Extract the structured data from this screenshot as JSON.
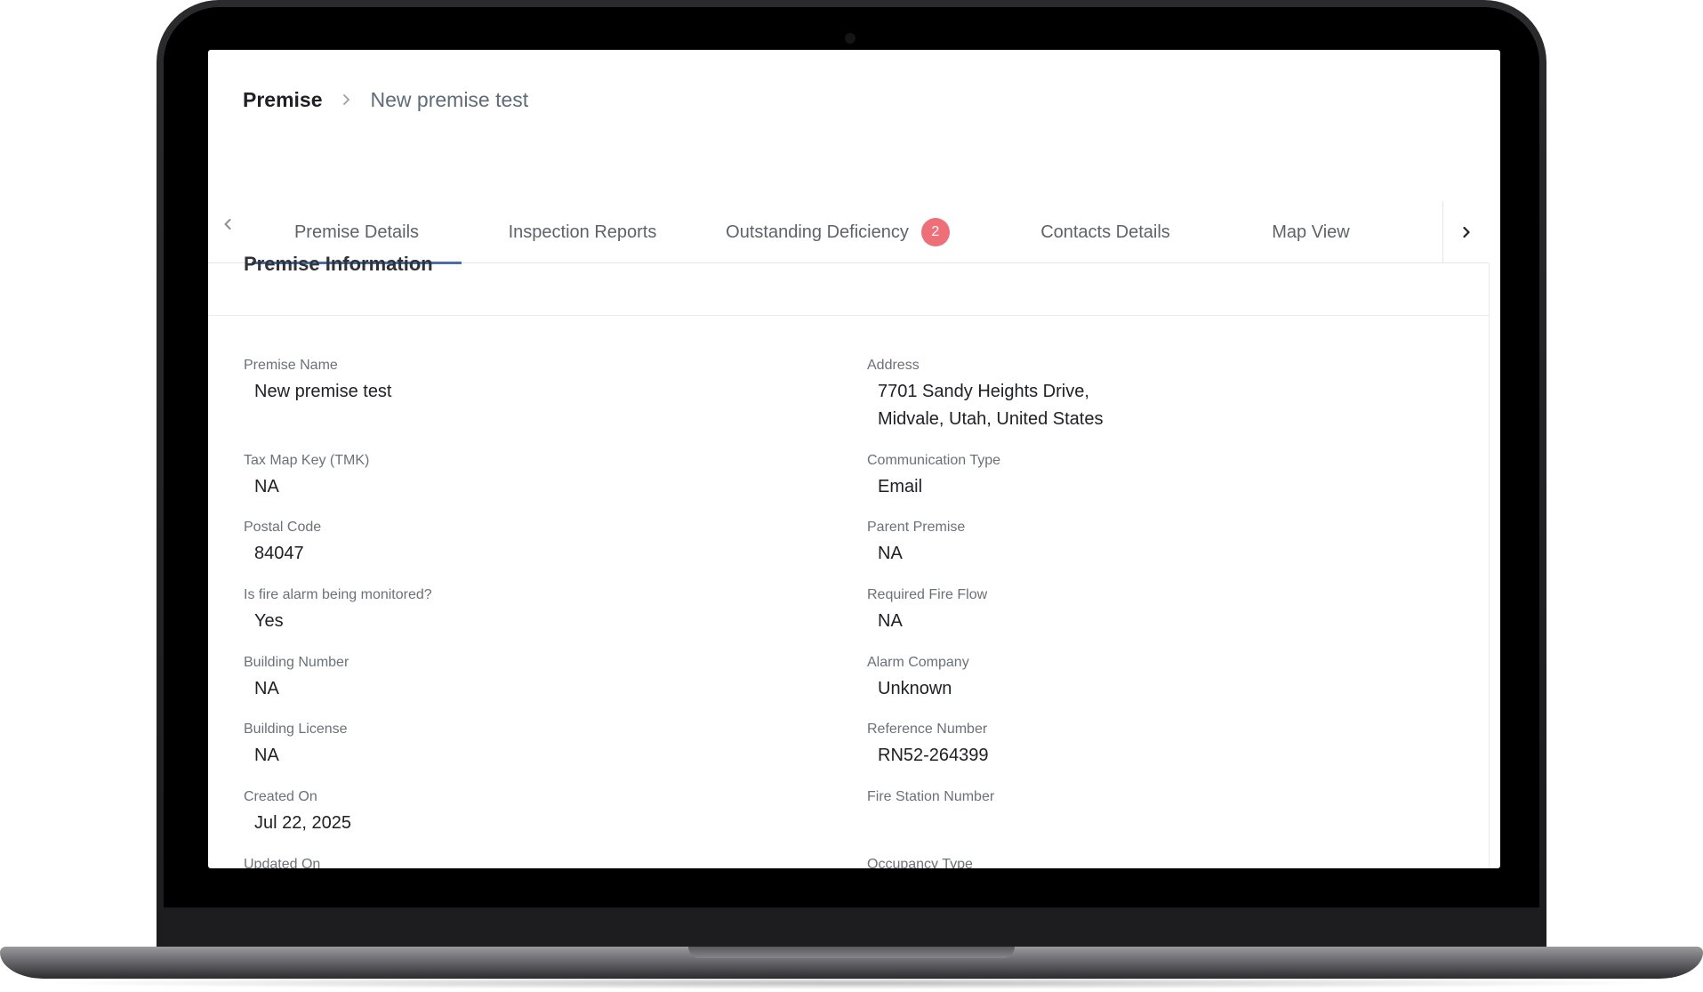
{
  "breadcrumb": {
    "root": "Premise",
    "current": "New premise test"
  },
  "tabs": [
    {
      "label": "Premise Details",
      "active": true
    },
    {
      "label": "Inspection Reports"
    },
    {
      "label": "Outstanding Deficiency",
      "badge": "2"
    },
    {
      "label": "Contacts Details"
    },
    {
      "label": "Map View"
    }
  ],
  "icons": {
    "breadcrumb_separator": "chevron-right-icon",
    "tab_scroll_left": "chevron-left-icon",
    "tab_scroll_right": "chevron-right-icon"
  },
  "colors": {
    "active_tab_indicator": "#4a6fa5",
    "badge": "#ef6f79"
  },
  "section": {
    "title": "Premise Information"
  },
  "fields": {
    "left": [
      {
        "label": "Premise Name",
        "value": "New premise test"
      },
      {
        "label": "Tax Map Key (TMK)",
        "value": "NA"
      },
      {
        "label": "Postal Code",
        "value": "84047"
      },
      {
        "label": "Is fire alarm being monitored?",
        "value": "Yes"
      },
      {
        "label": "Building Number",
        "value": "NA"
      },
      {
        "label": "Building License",
        "value": "NA"
      },
      {
        "label": "Created On",
        "value": "Jul 22, 2025"
      },
      {
        "label": "Updated On",
        "value": ""
      }
    ],
    "right": [
      {
        "label": "Address",
        "value_line1": "7701 Sandy Heights Drive,",
        "value_line2": "Midvale, Utah, United States"
      },
      {
        "label": "Communication Type",
        "value": "Email"
      },
      {
        "label": "Parent Premise",
        "value": "NA"
      },
      {
        "label": "Required Fire Flow",
        "value": "NA"
      },
      {
        "label": "Alarm Company",
        "value": "Unknown"
      },
      {
        "label": "Reference Number",
        "value": "RN52-264399"
      },
      {
        "label": "Fire Station Number",
        "value": ""
      },
      {
        "label": "Occupancy Type",
        "value": ""
      }
    ]
  }
}
